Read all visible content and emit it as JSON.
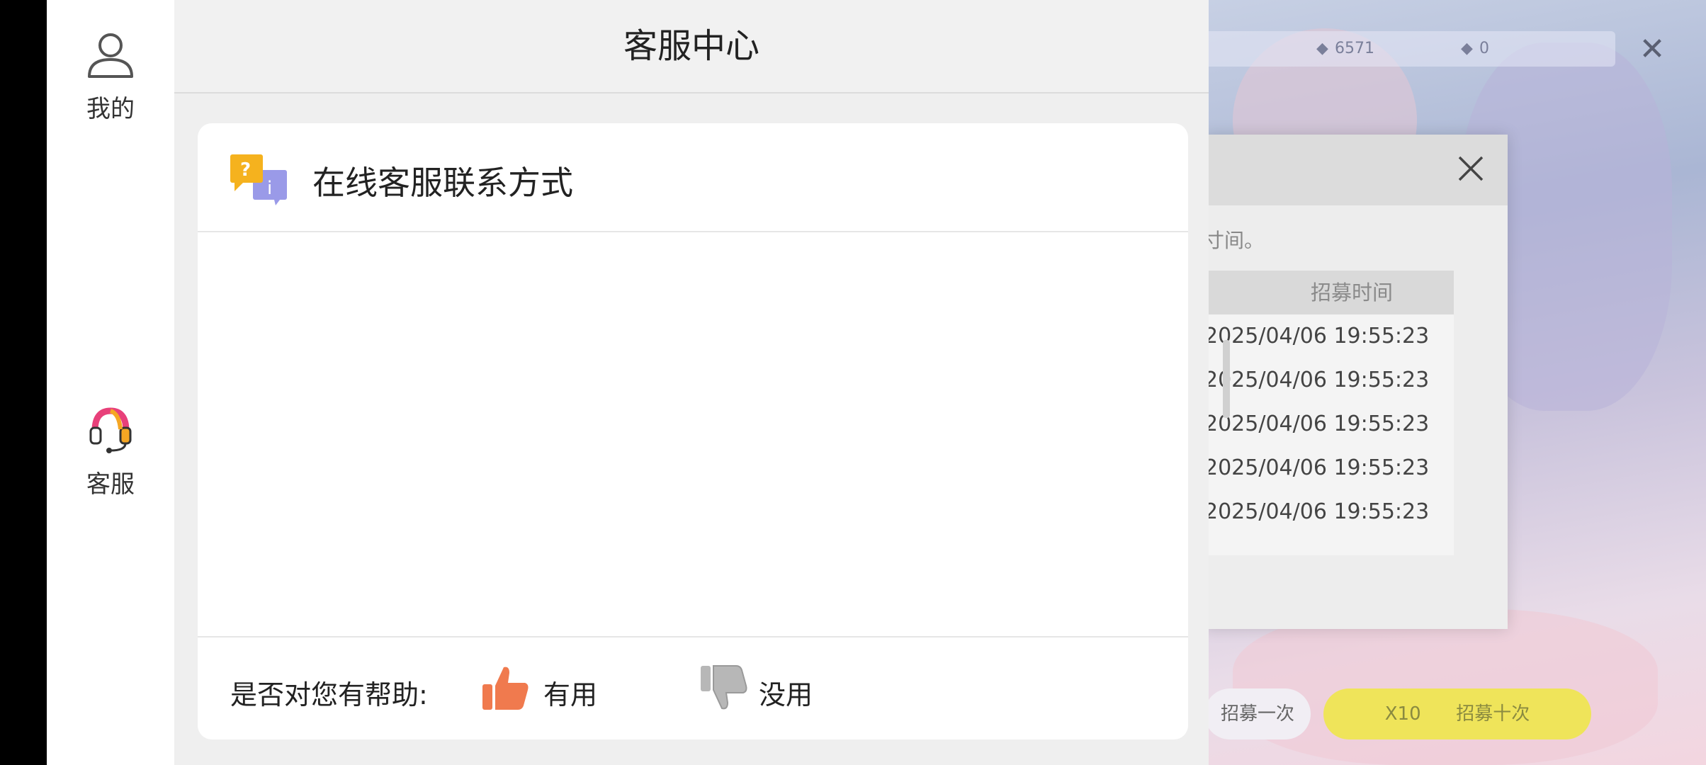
{
  "background_game": {
    "currency_purple": "6571",
    "currency_blue": "0",
    "recruit_once_label": "招募一次",
    "recruit_cost": "X10",
    "recruit_ten_label": "招募十次"
  },
  "history_modal": {
    "note_fragment": "寸间。",
    "column_header": "招募时间",
    "rows": [
      "2025/04/06 19:55:23",
      "2025/04/06 19:55:23",
      "2025/04/06 19:55:23",
      "2025/04/06 19:55:23",
      "2025/04/06 19:55:23"
    ]
  },
  "sidebar": {
    "items": [
      {
        "label": "我的",
        "icon": "person-icon"
      },
      {
        "label": "客服",
        "icon": "headset-icon"
      }
    ]
  },
  "header": {
    "title": "客服中心"
  },
  "card": {
    "title": "在线客服联系方式",
    "icon": "faq-icon"
  },
  "feedback": {
    "prompt": "是否对您有帮助:",
    "useful_label": "有用",
    "useless_label": "没用"
  },
  "colors": {
    "thumb_up": "#f07a4e",
    "thumb_down": "#b7b7b7",
    "nav_bg": "#ffffff",
    "panel_bg": "#efefef"
  }
}
